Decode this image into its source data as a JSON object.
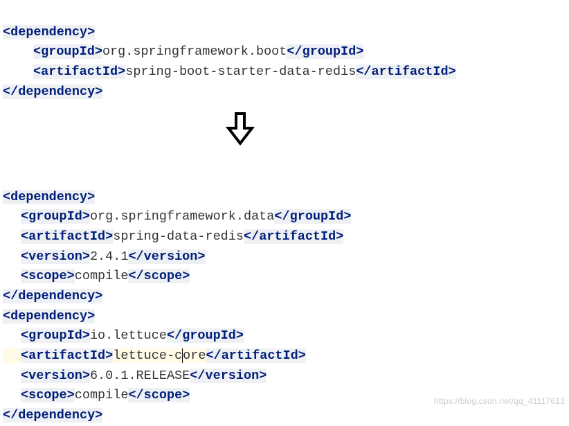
{
  "top": {
    "groupId": "org.springframework.boot",
    "artifactId": "spring-boot-starter-data-redis"
  },
  "deps": [
    {
      "groupId": "org.springframework.data",
      "artifactId": "spring-data-redis",
      "version": "2.4.1",
      "scope": "compile"
    },
    {
      "groupId": "io.lettuce",
      "artifactId_a": "lettuce-c",
      "artifactId_b": "ore",
      "version": "6.0.1.RELEASE",
      "scope": "compile"
    }
  ],
  "tags": {
    "dependency_open": "dependency",
    "dependency_close": "dependency",
    "groupId": "groupId",
    "artifactId": "artifactId",
    "version": "version",
    "scope": "scope"
  },
  "watermark": "https://blog.csdn.net/qq_41117613"
}
